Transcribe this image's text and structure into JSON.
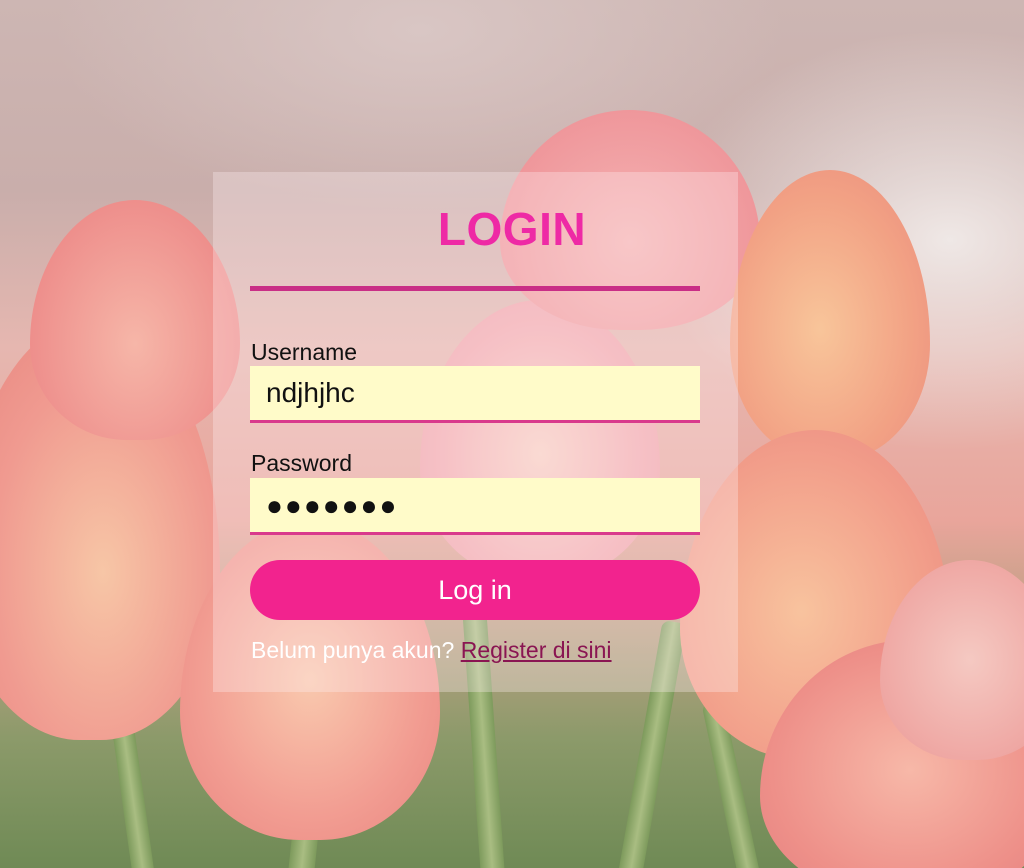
{
  "login": {
    "title": "LOGIN",
    "username_label": "Username",
    "username_value": "ndjhjhc",
    "password_label": "Password",
    "password_value": "●●●●●●●",
    "submit_label": "Log in",
    "register_prompt": "Belum punya akun?",
    "register_link": "Register di sini"
  },
  "colors": {
    "title": "#ee2aa5",
    "button": "#f2238e",
    "field_bg": "#fffbc9",
    "accent_rule": "#c92e86",
    "link": "#8a1552"
  }
}
